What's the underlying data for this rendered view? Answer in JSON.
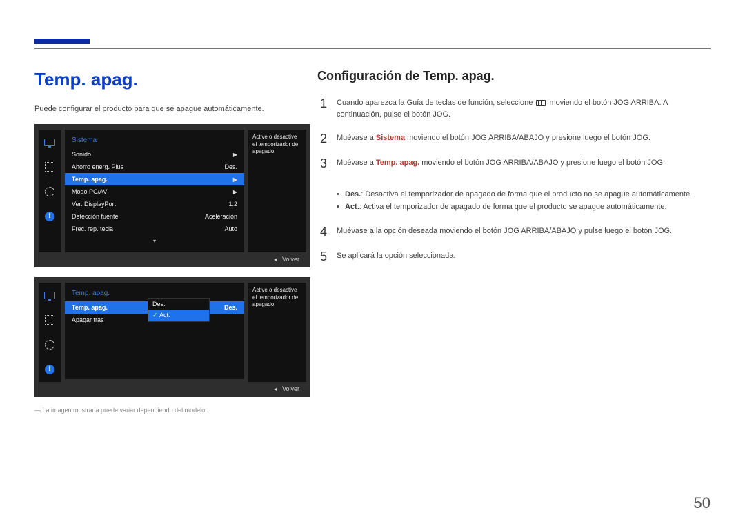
{
  "page_number": "50",
  "left": {
    "title": "Temp. apag.",
    "intro": "Puede configurar el producto para que se apague automáticamente.",
    "footnote": "La imagen mostrada puede variar dependiendo del modelo."
  },
  "osd1": {
    "heading": "Sistema",
    "rows": [
      {
        "label": "Sonido",
        "value": "▶"
      },
      {
        "label": "Ahorro energ. Plus",
        "value": "Des."
      },
      {
        "label": "Temp. apag.",
        "value": "▶",
        "selected": true
      },
      {
        "label": "Modo PC/AV",
        "value": "▶"
      },
      {
        "label": "Ver. DisplayPort",
        "value": "1.2"
      },
      {
        "label": "Detección fuente",
        "value": "Aceleración"
      },
      {
        "label": "Frec. rep. tecla",
        "value": "Auto"
      }
    ],
    "side": "Active o desactive el temporizador de apagado.",
    "footer_label": "Volver"
  },
  "osd2": {
    "heading": "Temp. apag.",
    "rows": [
      {
        "label": "Temp. apag.",
        "value": "Des.",
        "selected": true
      },
      {
        "label": "Apagar tras",
        "value": ""
      }
    ],
    "dropdown": {
      "items": [
        {
          "label": "Des."
        },
        {
          "label": "Act.",
          "selected": true
        }
      ]
    },
    "side": "Active o desactive el temporizador de apagado.",
    "footer_label": "Volver"
  },
  "right": {
    "title": "Configuración de Temp. apag.",
    "steps": {
      "s1a": "Cuando aparezca la Guía de teclas de función, seleccione ",
      "s1b": " moviendo el botón JOG ARRIBA. A continuación, pulse el botón JOG.",
      "s2a": "Muévase a ",
      "s2_hl": "Sistema",
      "s2b": " moviendo el botón JOG ARRIBA/ABAJO y presione luego el botón JOG.",
      "s3a": "Muévase a ",
      "s3_hl": "Temp. apag.",
      "s3b": " moviendo el botón JOG ARRIBA/ABAJO y presione luego el botón JOG.",
      "b1_hl": "Des.",
      "b1": ": Desactiva el temporizador de apagado de forma que el producto no se apague automáticamente.",
      "b2_hl": "Act.",
      "b2": ": Activa el temporizador de apagado de forma que el producto se apague automáticamente.",
      "s4": "Muévase a la opción deseada moviendo el botón JOG ARRIBA/ABAJO y pulse luego el botón JOG.",
      "s5": "Se aplicará la opción seleccionada."
    }
  }
}
